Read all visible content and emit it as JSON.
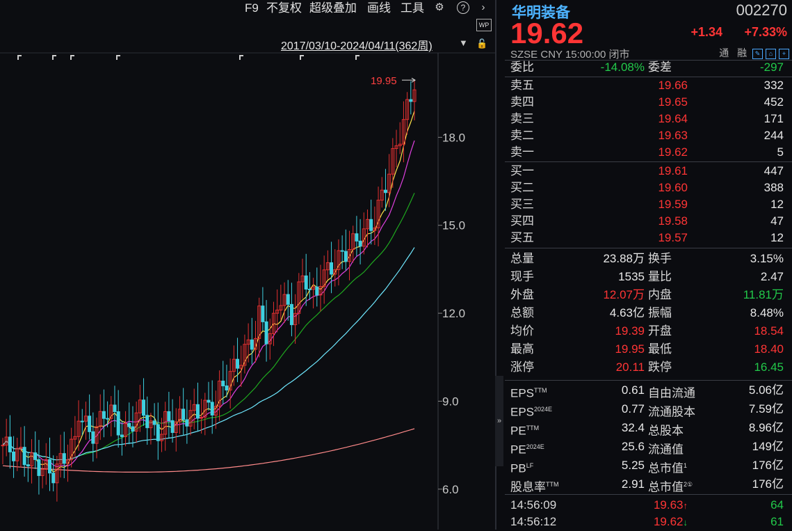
{
  "toolbar": {
    "f9": "F9",
    "adjust": "不复权",
    "overlay": "超级叠加",
    "draw": "画线",
    "tools": "工具",
    "wp_label": "WP",
    "date_range": "2017/03/10-2024/04/11(362周)"
  },
  "chart_data": {
    "type": "candlestick",
    "y_ticks": [
      "18.0",
      "15.0",
      "12.0",
      "9.0",
      "6.0"
    ],
    "y_tick_values": [
      18,
      15,
      12,
      9,
      6
    ],
    "ylim": [
      5.0,
      20.5
    ],
    "high_label": "19.95",
    "high_value": 19.95,
    "last_close": 19.62,
    "ma_colors": {
      "ma5": "#ffffff",
      "ma10": "#ffe34a",
      "ma20": "#e040e0",
      "ma30": "#1fa81f",
      "ma60": "#6fe8ff",
      "ma120": "#ff8a8a"
    }
  },
  "quote": {
    "name": "华明装备",
    "code": "002270",
    "price": "19.62",
    "change": "+1.34",
    "change_pct": "+7.33%",
    "exchange": "SZSE",
    "currency": "CNY",
    "time": "15:00:00",
    "status": "闭市",
    "tong": "通",
    "rong": "融"
  },
  "order_ratio": {
    "label1": "委比",
    "value1": "-14.08%",
    "label2": "委差",
    "value2": "-297"
  },
  "asks": [
    {
      "label": "卖五",
      "price": "19.66",
      "volume": "332"
    },
    {
      "label": "卖四",
      "price": "19.65",
      "volume": "452"
    },
    {
      "label": "卖三",
      "price": "19.64",
      "volume": "171"
    },
    {
      "label": "卖二",
      "price": "19.63",
      "volume": "244"
    },
    {
      "label": "卖一",
      "price": "19.62",
      "volume": "5"
    }
  ],
  "bids": [
    {
      "label": "买一",
      "price": "19.61",
      "volume": "447"
    },
    {
      "label": "买二",
      "price": "19.60",
      "volume": "388"
    },
    {
      "label": "买三",
      "price": "19.59",
      "volume": "12"
    },
    {
      "label": "买四",
      "price": "19.58",
      "volume": "47"
    },
    {
      "label": "买五",
      "price": "19.57",
      "volume": "12"
    }
  ],
  "stats": [
    {
      "l1": "总量",
      "v1": "23.88万",
      "c1": "white",
      "l2": "换手",
      "v2": "3.15%",
      "c2": "white"
    },
    {
      "l1": "现手",
      "v1": "1535",
      "c1": "white",
      "l2": "量比",
      "v2": "2.47",
      "c2": "white"
    },
    {
      "l1": "外盘",
      "v1": "12.07万",
      "c1": "red",
      "l2": "内盘",
      "v2": "11.81万",
      "c2": "green"
    },
    {
      "l1": "总额",
      "v1": "4.63亿",
      "c1": "white",
      "l2": "振幅",
      "v2": "8.48%",
      "c2": "white"
    },
    {
      "l1": "均价",
      "v1": "19.39",
      "c1": "red",
      "l2": "开盘",
      "v2": "18.54",
      "c2": "red"
    },
    {
      "l1": "最高",
      "v1": "19.95",
      "c1": "red",
      "l2": "最低",
      "v2": "18.40",
      "c2": "red"
    },
    {
      "l1": "涨停",
      "v1": "20.11",
      "c1": "red",
      "l2": "跌停",
      "v2": "16.45",
      "c2": "green"
    }
  ],
  "fundamentals": [
    {
      "l1": "EPS",
      "s1": "TTM",
      "v1": "0.61",
      "l2": "自由流通",
      "s2": "",
      "v2": "5.06亿"
    },
    {
      "l1": "EPS",
      "s1": "2024E",
      "v1": "0.77",
      "l2": "流通股本",
      "s2": "",
      "v2": "7.59亿"
    },
    {
      "l1": "PE",
      "s1": "TTM",
      "v1": "32.4",
      "l2": "总股本",
      "s2": "",
      "v2": "8.96亿"
    },
    {
      "l1": "PE",
      "s1": "2024E",
      "v1": "25.6",
      "l2": "流通值",
      "s2": "",
      "v2": "149亿"
    },
    {
      "l1": "PB",
      "s1": "LF",
      "v1": "5.25",
      "l2": "总市值",
      "s2": "1",
      "v2": "176亿"
    },
    {
      "l1": "股息率",
      "s1": "TTM",
      "v1": "2.91",
      "l2": "总市值",
      "s2": "2①",
      "v2": "176亿"
    }
  ],
  "ticks": [
    {
      "time": "14:56:09",
      "price": "19.63",
      "dir": "↑",
      "dir_color": "red",
      "vol": "64"
    },
    {
      "time": "14:56:12",
      "price": "19.62",
      "dir": "↓",
      "dir_color": "green",
      "vol": "61"
    }
  ]
}
